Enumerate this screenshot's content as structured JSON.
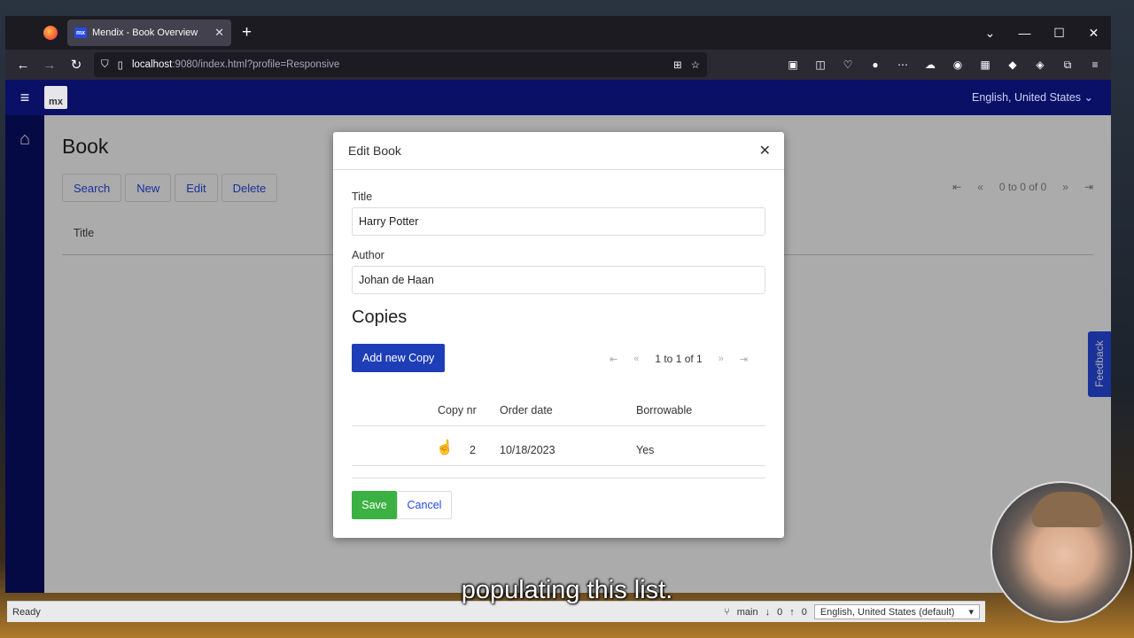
{
  "browser": {
    "tab_title": "Mendix - Book Overview",
    "tab_favicon": "mx",
    "url_host": "localhost",
    "url_rest": ":9080/index.html?profile=Responsive"
  },
  "app": {
    "logo": "mx",
    "language": "English, United States",
    "page_title": "Book",
    "buttons": [
      "Search",
      "New",
      "Edit",
      "Delete"
    ],
    "paging": "0 to 0 of 0",
    "column_title": "Title",
    "feedback": "Feedback"
  },
  "modal": {
    "title": "Edit Book",
    "title_label": "Title",
    "title_value": "Harry Potter",
    "author_label": "Author",
    "author_value": "Johan de Haan",
    "section": "Copies",
    "add_button": "Add new Copy",
    "paging": "1 to 1 of 1",
    "columns": [
      "Copy nr",
      "Order date",
      "Borrowable"
    ],
    "rows": [
      {
        "copy_nr": "2",
        "order_date": "10/18/2023",
        "borrowable": "Yes"
      }
    ],
    "save": "Save",
    "cancel": "Cancel"
  },
  "statusbar": {
    "status": "Ready",
    "branch": "main",
    "down": "0",
    "up": "0",
    "language": "English, United States (default)"
  },
  "caption": "populating this list.",
  "colors": {
    "header": "#0a1066",
    "primary": "#264ae5",
    "save": "#3bb141"
  }
}
